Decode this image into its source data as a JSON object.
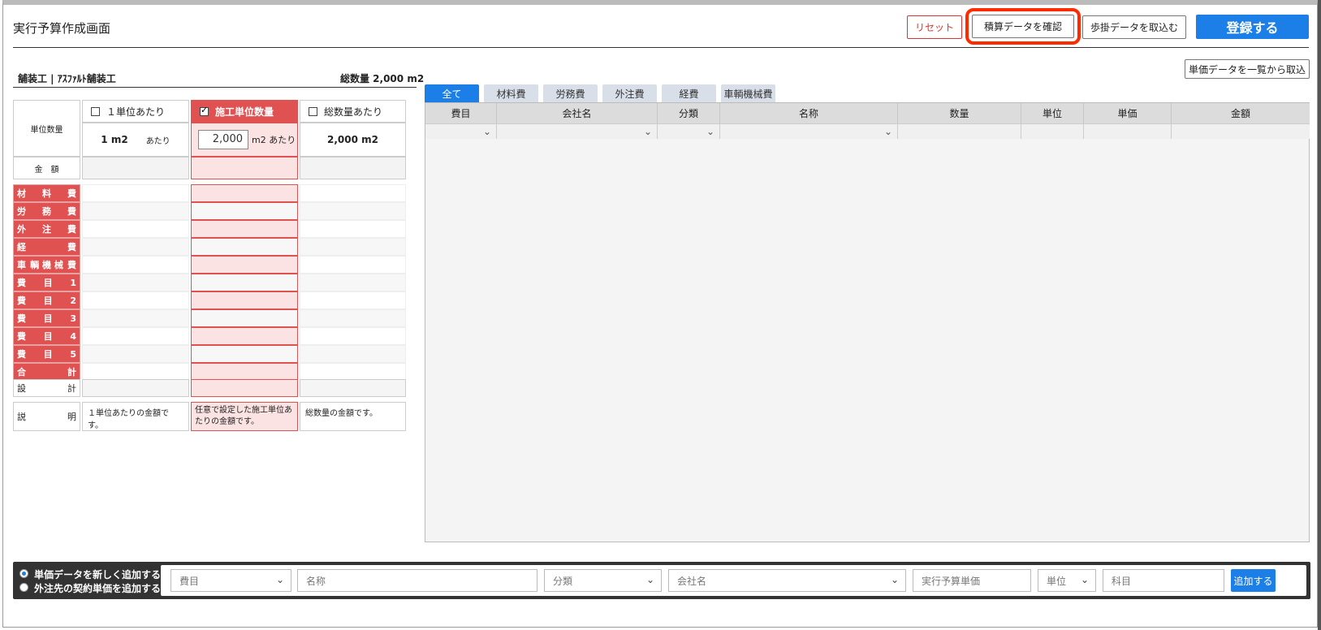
{
  "header": {
    "title": "実行予算作成画面",
    "reset_label": "リセット",
    "confirm_label": "積算データを確認",
    "import_label": "歩掛データを取込む",
    "register_label": "登録する"
  },
  "section": {
    "name": "舗装工 | ｱｽﾌｧﾙﾄ舗装工",
    "total": "総数量 2,000 m2",
    "unit_import_label": "単価データを一覧から取込"
  },
  "calc": {
    "unit_qty_label": "単位数量",
    "amount_label": "金　額",
    "col1": {
      "label": "１単位あたり",
      "qty": "1 m2",
      "per": "あたり",
      "desc": "１単位あたりの金額です。"
    },
    "col2": {
      "label": "施工単位数量",
      "qty_value": "2,000",
      "unit": "m2 あたり",
      "desc": "任意で設定した施工単位あたりの金額です。"
    },
    "col3": {
      "label": "総数量あたり",
      "qty": "2,000 m2",
      "desc": "総数量の金額です。"
    },
    "rows": [
      {
        "label": "材料費",
        "l": "材",
        "m": "料",
        "r": "費"
      },
      {
        "label": "労務費",
        "l": "労",
        "m": "務",
        "r": "費"
      },
      {
        "label": "外注費",
        "l": "外",
        "m": "注",
        "r": "費"
      },
      {
        "label": "経費",
        "l": "経",
        "m": "",
        "r": "費"
      },
      {
        "label": "車輌機械費",
        "l": "車",
        "m": "輌 機 械",
        "r": "費"
      },
      {
        "label": "費目1",
        "l": "費",
        "m": "目",
        "r": "1"
      },
      {
        "label": "費目2",
        "l": "費",
        "m": "目",
        "r": "2"
      },
      {
        "label": "費目3",
        "l": "費",
        "m": "目",
        "r": "3"
      },
      {
        "label": "費目4",
        "l": "費",
        "m": "目",
        "r": "4"
      },
      {
        "label": "費目5",
        "l": "費",
        "m": "目",
        "r": "5"
      },
      {
        "label": "合計",
        "l": "合",
        "m": "",
        "r": "計"
      }
    ],
    "design_l": "設",
    "design_r": "計",
    "note_l": "説",
    "note_r": "明"
  },
  "tabs": [
    "全て",
    "材料費",
    "労務費",
    "外注費",
    "経費",
    "車輌機械費"
  ],
  "grid": {
    "columns": [
      "費目",
      "会社名",
      "分類",
      "名称",
      "数量",
      "単位",
      "単価",
      "金額"
    ]
  },
  "bottom": {
    "option1": "単価データを新しく追加する",
    "option2": "外注先の契約単価を追加する",
    "fields": {
      "himoku": "費目",
      "name": "名称",
      "bunrui": "分類",
      "company": "会社名",
      "unit_price": "実行予算単価",
      "unit": "単位",
      "kamoku": "科目"
    },
    "add_label": "追加する"
  },
  "colors": {
    "accent": "#1c7fe8",
    "red": "#e05252",
    "highlight": "#ff2a00"
  }
}
